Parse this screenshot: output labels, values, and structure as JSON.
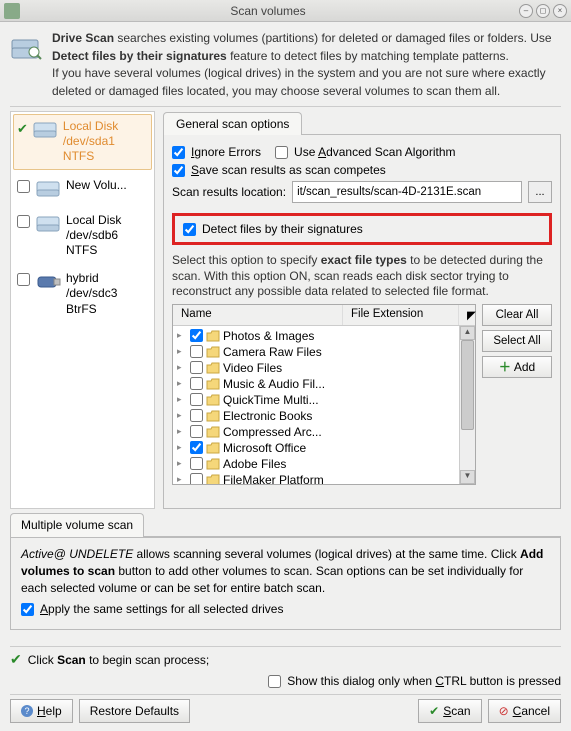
{
  "window": {
    "title": "Scan volumes"
  },
  "intro": {
    "lead1": "Drive Scan",
    "text1": " searches existing volumes (partitions) for deleted or damaged files or folders. Use ",
    "lead2": "Detect files by their signatures",
    "text2": " feature to detect files by matching template patterns.",
    "text3": "If you have several volumes (logical drives) in the system and you are not sure where exactly deleted or damaged files located, you may choose several volumes to scan them all."
  },
  "volumes": [
    {
      "line1": "Local Disk",
      "line2": "/dev/sda1",
      "line3": "NTFS",
      "checked": true,
      "removable": false
    },
    {
      "line1": "New Volu...",
      "line2": "",
      "line3": "",
      "checked": false,
      "removable": false
    },
    {
      "line1": "Local Disk",
      "line2": "/dev/sdb6",
      "line3": "NTFS",
      "checked": false,
      "removable": false
    },
    {
      "line1": "hybrid",
      "line2": "/dev/sdc3",
      "line3": "BtrFS",
      "checked": false,
      "removable": true
    }
  ],
  "tabs": {
    "general": "General scan options"
  },
  "opts": {
    "ignore": "Ignore Errors",
    "advanced": "Use Advanced Scan Algorithm",
    "save": "Save scan results as scan competes",
    "loc_label": "Scan results location:",
    "loc_value": "it/scan_results/scan-4D-2131E.scan",
    "browse": "..."
  },
  "detect": {
    "toggle": "Detect files by their signatures",
    "desc1": "Select this option to specify ",
    "desc_bold": "exact file types",
    "desc2": " to be detected during the scan. With this option ON, scan reads each disk sector trying to reconstruct any possible data related to selected file format."
  },
  "grid": {
    "col1": "Name",
    "col2": "File Extension",
    "rows": [
      {
        "label": "Photos & Images",
        "checked": true
      },
      {
        "label": "Camera Raw Files",
        "checked": false
      },
      {
        "label": "Video Files",
        "checked": false
      },
      {
        "label": "Music & Audio Fil...",
        "checked": false
      },
      {
        "label": "QuickTime Multi...",
        "checked": false
      },
      {
        "label": "Electronic Books",
        "checked": false
      },
      {
        "label": "Compressed Arc...",
        "checked": false
      },
      {
        "label": "Microsoft Office",
        "checked": true
      },
      {
        "label": "Adobe Files",
        "checked": false
      },
      {
        "label": "FileMaker Platform",
        "checked": false
      }
    ]
  },
  "sidebtns": {
    "clear": "Clear All",
    "select": "Select All",
    "add": "Add"
  },
  "mv": {
    "tab": "Multiple volume scan",
    "desc1": "Active@ UNDELETE ",
    "desc2": "allows scanning several volumes (logical drives) at the same time. Click ",
    "desc_bold": "Add volumes to scan",
    "desc3": " button to add other volumes to scan. Scan options can be set individually for each selected volume or can be set for entire batch scan.",
    "apply": "Apply the same settings for all selected drives"
  },
  "footer": {
    "scan_hint": "Click Scan to begin scan process;",
    "show_dialog": "Show this dialog only when CTRL button is pressed"
  },
  "buttons": {
    "help": "Help",
    "restore": "Restore Defaults",
    "scan": "Scan",
    "cancel": "Cancel"
  }
}
